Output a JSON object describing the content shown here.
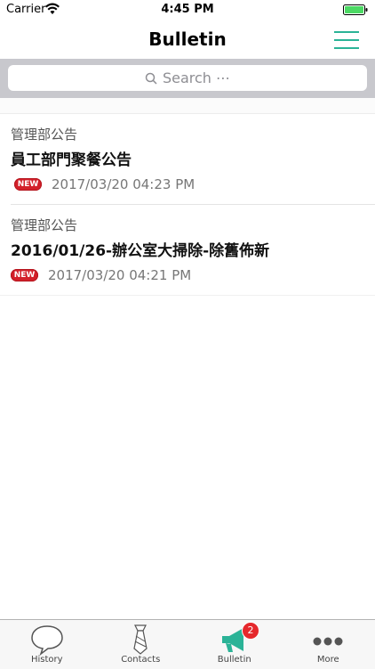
{
  "status_bar": {
    "carrier": "Carrier",
    "time": "4:45 PM"
  },
  "nav": {
    "title": "Bulletin"
  },
  "search": {
    "placeholder": "Search ⋯"
  },
  "bulletins": [
    {
      "department": "管理部公告",
      "title": "員工部門聚餐公告",
      "badge": "NEW",
      "date": "2017/03/20 04:23 PM"
    },
    {
      "department": "管理部公告",
      "title": "2016/01/26-辦公室大掃除-除舊佈新",
      "badge": "NEW",
      "date": "2017/03/20 04:21 PM"
    }
  ],
  "tabs": [
    {
      "label": "History",
      "icon": "speech-bubble-icon"
    },
    {
      "label": "Contacts",
      "icon": "tie-icon"
    },
    {
      "label": "Bulletin",
      "icon": "megaphone-icon",
      "badge": "2"
    },
    {
      "label": "More",
      "icon": "more-dots-icon"
    }
  ],
  "colors": {
    "accent": "#2bb397",
    "badge": "#e5282c",
    "new_badge": "#d3202a"
  }
}
